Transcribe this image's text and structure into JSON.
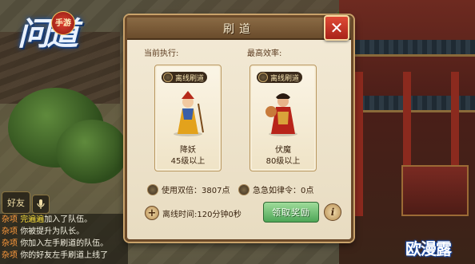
{
  "logo": {
    "text": "问道",
    "badge": "手游"
  },
  "dialog": {
    "title": "刷道",
    "close_label": "✕",
    "current_label": "当前执行:",
    "best_label": "最高效率:",
    "cards": [
      {
        "tag": "离线刷道",
        "name": "降妖",
        "level": "45级以上"
      },
      {
        "tag": "离线刷道",
        "name": "伏魔",
        "level": "80级以上"
      }
    ],
    "double_label": "使用双倍：3807点",
    "urgent_label": "急急如律令：0点",
    "offline_time": "离线时间:120分钟0秒",
    "claim_label": "领取奖励",
    "info_label": "i",
    "plus_label": "+"
  },
  "world": {
    "friend_label": "好友",
    "mic_icon": "mic-icon"
  },
  "chat": [
    {
      "tag": "杂项",
      "who": "完遍遍",
      "text": "加入了队伍。"
    },
    {
      "tag": "杂项",
      "who": "",
      "text": "你被提升为队长。"
    },
    {
      "tag": "杂项",
      "who": "",
      "text": "你加入左手刷道的队伍。"
    },
    {
      "tag": "杂项",
      "who": "",
      "text": "你的好友左手刷道上线了"
    }
  ],
  "watermark": "欧漫露"
}
